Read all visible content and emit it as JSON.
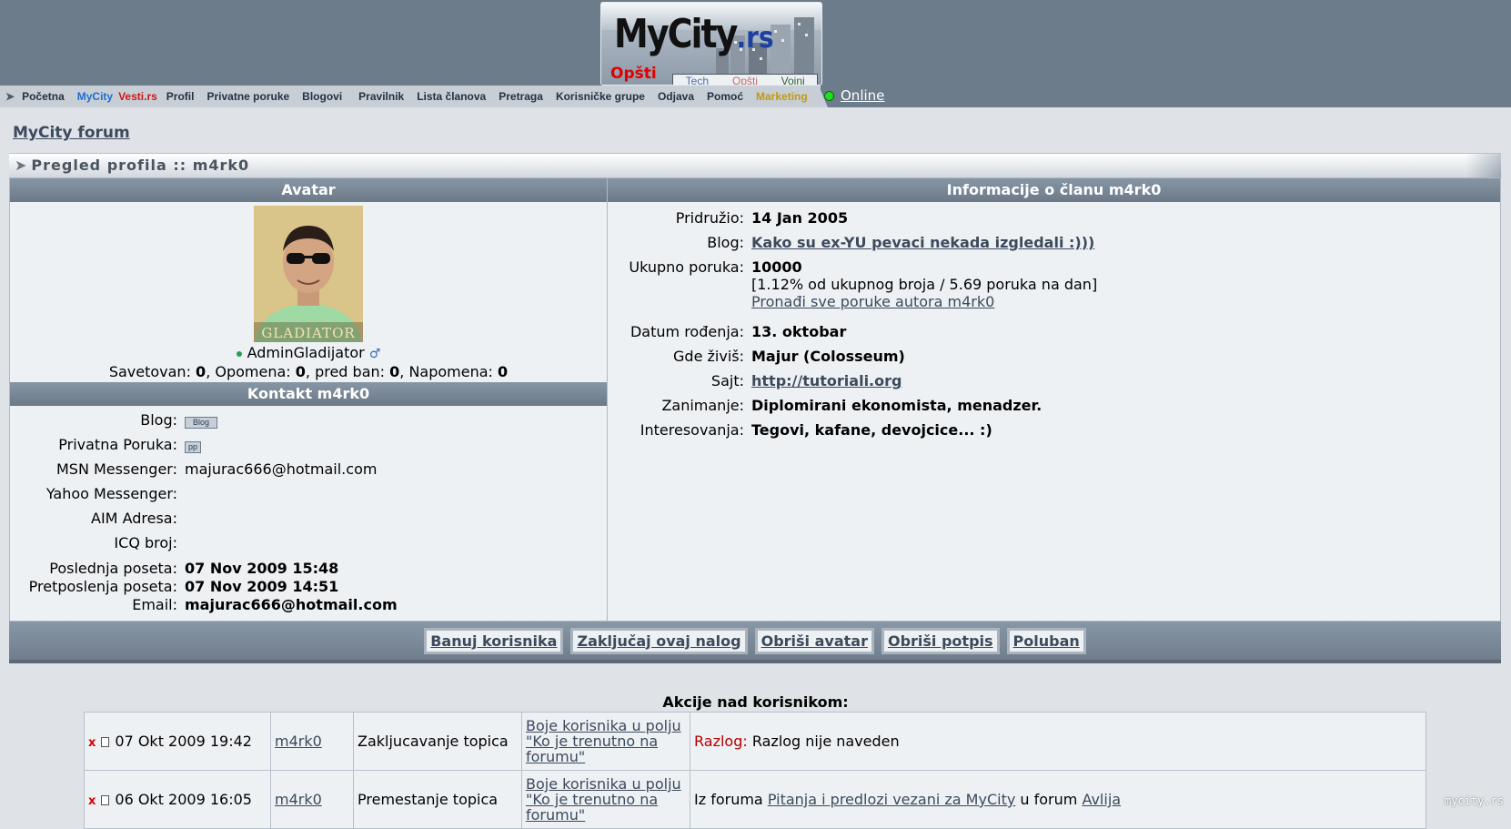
{
  "logo": {
    "name": "MyCity",
    "tld": ".rs",
    "section": "Opšti",
    "tabs": [
      "Tech",
      "Opšti",
      "Vojni"
    ],
    "colors": {
      "tech": "#4a6fa5",
      "opsti": "#c26a6a",
      "vojni": "#2f5f2f"
    }
  },
  "nav": {
    "items": [
      {
        "label": "Početna",
        "color": "#233142"
      },
      {
        "label": "MyCity",
        "color": "#1e6fd0"
      },
      {
        "label": "Vesti.rs",
        "color": "#d01818"
      },
      {
        "label": "Profil",
        "color": "#233142"
      },
      {
        "label": "Privatne poruke",
        "color": "#233142"
      },
      {
        "label": "Blogovi",
        "color": "#233142"
      },
      {
        "label": "Pravilnik",
        "color": "#233142"
      },
      {
        "label": "Lista članova",
        "color": "#233142"
      },
      {
        "label": "Pretraga",
        "color": "#233142"
      },
      {
        "label": "Korisničke grupe",
        "color": "#233142"
      },
      {
        "label": "Odjava",
        "color": "#233142"
      },
      {
        "label": "Pomoć",
        "color": "#233142"
      },
      {
        "label": "Marketing",
        "color": "#c29a10"
      }
    ],
    "online": "Online"
  },
  "breadcrumb": "MyCity forum",
  "title": "Pregled profila :: m4rk0",
  "avatar_panel": {
    "header": "Avatar",
    "avatar_caption": "GLADIATOR",
    "username": "AdminGladijator",
    "gender_icon": "male-icon",
    "warnings": [
      {
        "label": "Savetovan",
        "value": "0"
      },
      {
        "label": "Opomena",
        "value": "0"
      },
      {
        "label": "pred ban",
        "value": "0"
      },
      {
        "label": "Napomena",
        "value": "0"
      }
    ]
  },
  "contact": {
    "header": "Kontakt m4rk0",
    "blog_label": "Blog:",
    "blog_btn": "Blog",
    "pm_label": "Privatna Poruka:",
    "pm_btn": "pp",
    "msn_label": "MSN Messenger:",
    "msn_value": "majurac666@hotmail.com",
    "yahoo_label": "Yahoo Messenger:",
    "aim_label": "AIM Adresa:",
    "icq_label": "ICQ broj:",
    "last_label": "Poslednja poseta:",
    "last_value": "07 Nov 2009 15:48",
    "prev_label": "Pretposlenja poseta:",
    "prev_value": "07 Nov 2009 14:51",
    "email_label": "Email:",
    "email_value": "majurac666@hotmail.com"
  },
  "info": {
    "header": "Informacije o članu m4rk0",
    "joined_label": "Pridružio:",
    "joined_value": "14 Jan 2005",
    "blog_label": "Blog:",
    "blog_value": "Kako su ex-YU pevaci nekada izgledali :)))",
    "posts_label": "Ukupno poruka:",
    "posts_value": "10000",
    "posts_stats": "[1.12% od ukupnog broja / 5.69 poruka na dan]",
    "posts_find": "Pronađi sve poruke autora m4rk0",
    "birthday_label": "Datum rođenja:",
    "birthday_value": "13. oktobar",
    "location_label": "Gde živiš:",
    "location_value": "Majur (Colosseum)",
    "site_label": "Sajt:",
    "site_value": "http://tutoriali.org",
    "occupation_label": "Zanimanje:",
    "occupation_value": "Diplomirani ekonomista, menadzer.",
    "interests_label": "Interesovanja:",
    "interests_value": "Tegovi, kafane, devojcice... :)"
  },
  "admin_buttons": [
    "Banuj korisnika",
    "Zaključaj ovaj nalog",
    "Obriši avatar",
    "Obriši potpis",
    "Poluban"
  ],
  "actions": {
    "title": "Akcije nad korisnikom:",
    "rows": [
      {
        "x": "x",
        "date": "07 Okt 2009 19:42",
        "user": "m4rk0",
        "action": "Zakljucavanje topica",
        "topic": "Boje korisnika u polju \"Ko je trenutno na forumu\"",
        "reason_label": "Razlog:",
        "reason": "Razlog nije naveden"
      },
      {
        "x": "x",
        "date": "06 Okt 2009 16:05",
        "user": "m4rk0",
        "action": "Premestanje topica",
        "topic": "Boje korisnika u polju \"Ko je trenutno na forumu\"",
        "from_prefix": "Iz foruma",
        "from_forum": "Pitanja i predlozi vezani za MyCity",
        "to_prefix": "u forum",
        "to_forum": "Avlija"
      }
    ]
  },
  "watermark": "mycity.rs"
}
